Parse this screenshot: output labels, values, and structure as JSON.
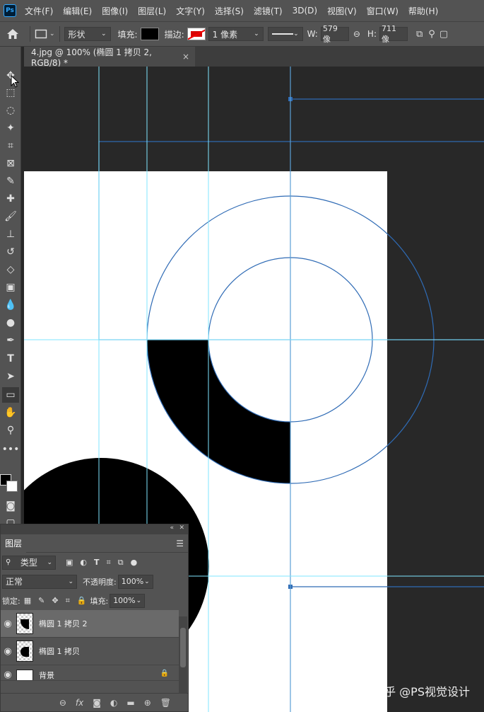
{
  "menubar": {
    "logo": "Ps",
    "items": [
      "文件(F)",
      "编辑(E)",
      "图像(I)",
      "图层(L)",
      "文字(Y)",
      "选择(S)",
      "滤镜(T)",
      "3D(D)",
      "视图(V)",
      "窗口(W)",
      "帮助(H)"
    ]
  },
  "options": {
    "mode": "形状",
    "fill_label": "填充:",
    "stroke_label": "描边:",
    "stroke_width": "1 像素",
    "w_label": "W:",
    "w_value": "579 像",
    "h_label": "H:",
    "h_value": "711 像"
  },
  "document": {
    "tab_title": "4.jpg @ 100% (椭圆 1 拷贝 2, RGB/8) *",
    "close": "×"
  },
  "layers_panel": {
    "title": "图层",
    "filter_label": "类型",
    "blend_mode": "正常",
    "opacity_label": "不透明度:",
    "opacity_value": "100%",
    "lock_label": "锁定:",
    "fill_label": "填充:",
    "fill_value": "100%",
    "layers": [
      {
        "name": "椭圆 1 拷贝 2",
        "selected": true
      },
      {
        "name": "椭圆 1 拷贝",
        "selected": false
      },
      {
        "name": "背景",
        "selected": false
      }
    ]
  },
  "watermark": "知乎 @PS视觉设计",
  "colors": {
    "chrome": "#535353",
    "canvas_bg": "#282828",
    "guide": "#7fe6ff",
    "path": "#2f6bb5"
  }
}
